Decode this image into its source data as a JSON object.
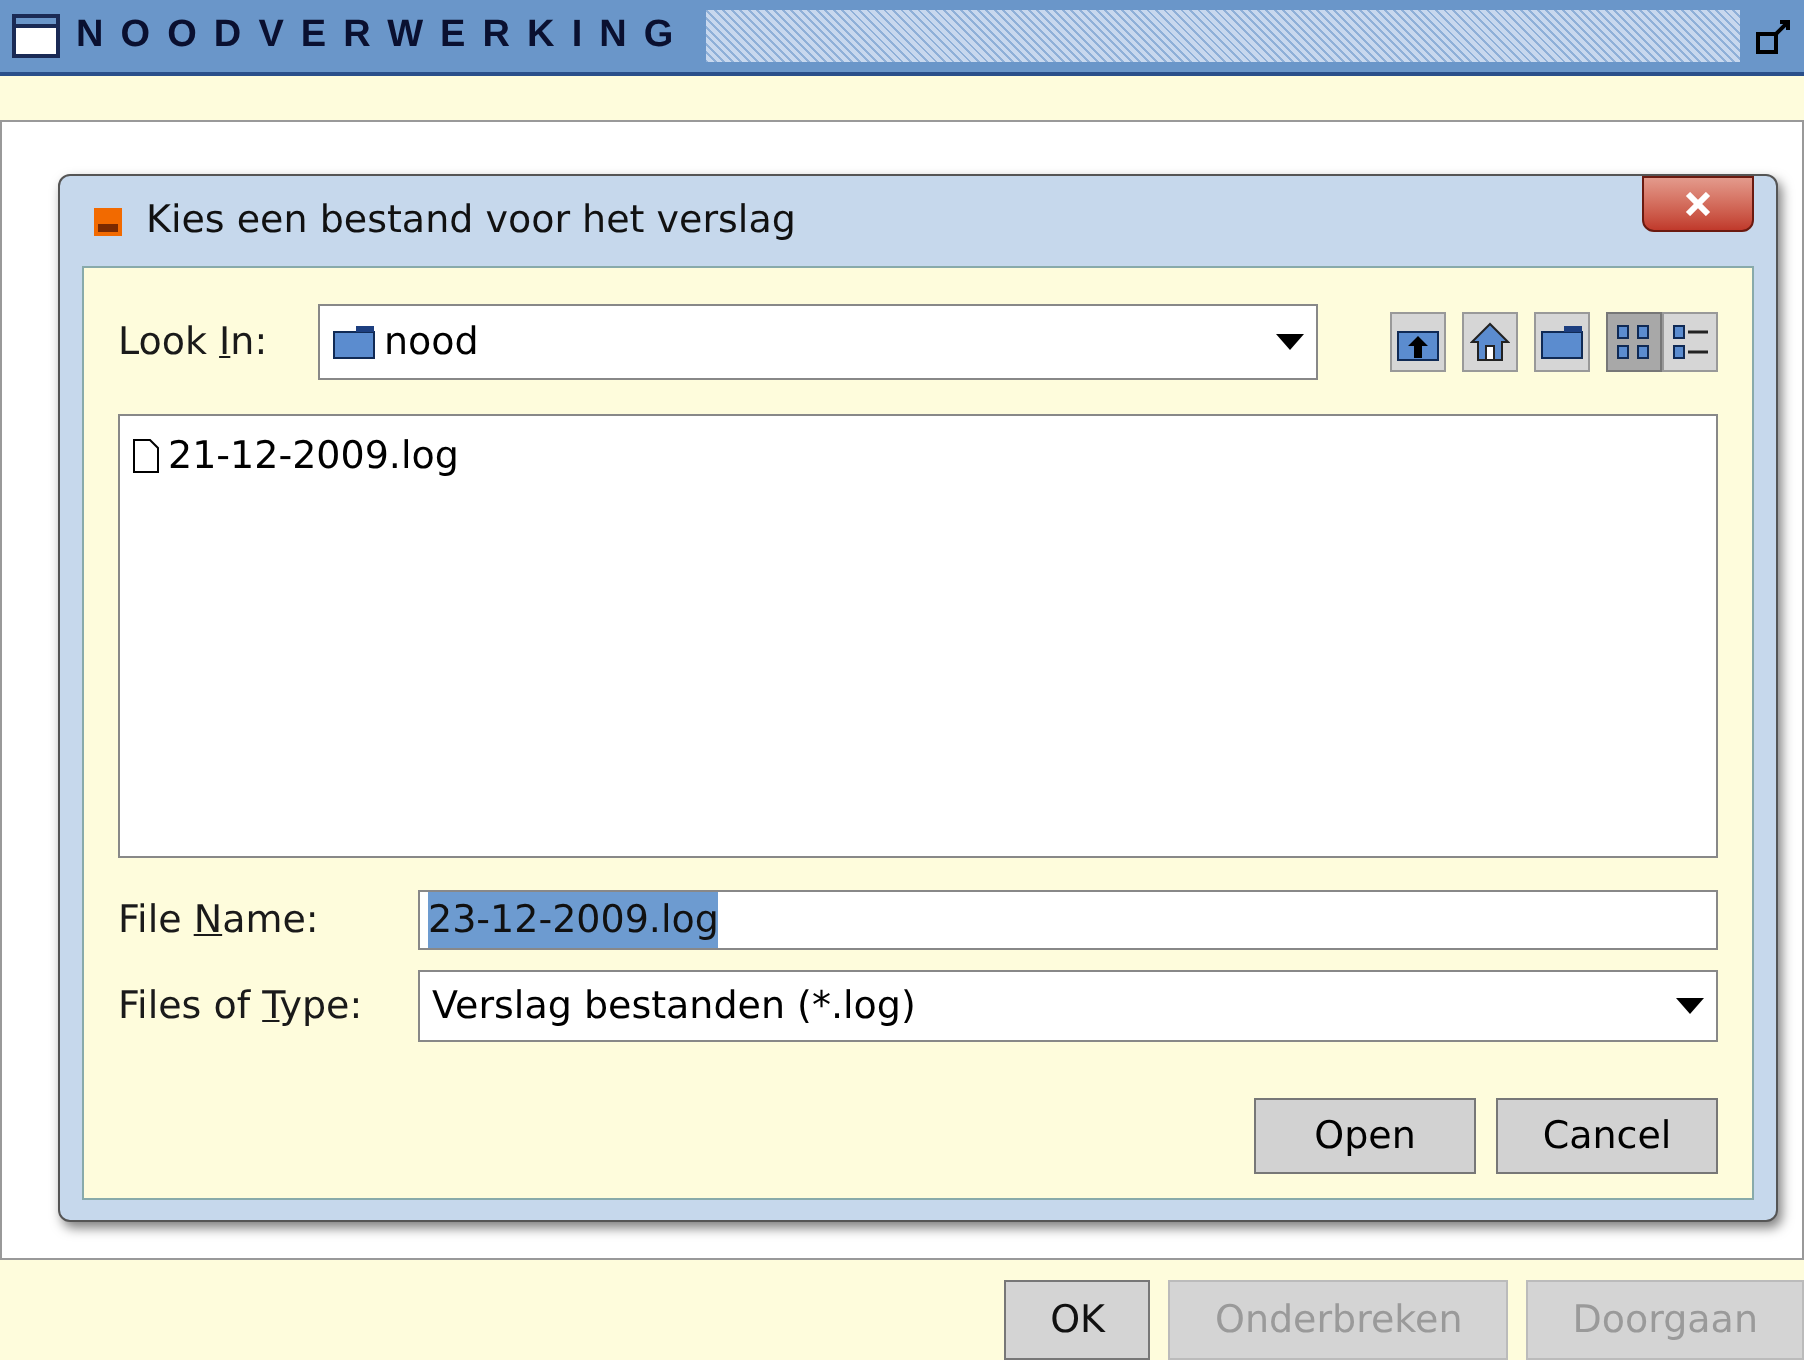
{
  "window": {
    "title": "NOODVERWERKING"
  },
  "dialog": {
    "title": "Kies een bestand voor het verslag",
    "look_in": {
      "label": {
        "pre": "Look ",
        "key": "I",
        "post": "n:"
      },
      "value": "nood"
    },
    "toolbar": [
      {
        "kind": "up",
        "selected": false
      },
      {
        "kind": "home",
        "selected": false
      },
      {
        "kind": "newfolder",
        "selected": false
      },
      {
        "kind": "list",
        "selected": true
      },
      {
        "kind": "details",
        "selected": false
      }
    ],
    "files": [
      {
        "name": "21-12-2009.log"
      }
    ],
    "file_name": {
      "label": {
        "pre": "File ",
        "key": "N",
        "post": "ame:"
      },
      "value": "23-12-2009.log"
    },
    "file_type": {
      "label": {
        "pre": "Files of ",
        "key": "T",
        "post": "ype:"
      },
      "value": "Verslag bestanden (*.log)"
    },
    "buttons": [
      "Open",
      "Cancel"
    ]
  },
  "footer_buttons": [
    {
      "label": "OK",
      "disabled": false
    },
    {
      "label": "Onderbreken",
      "disabled": true
    },
    {
      "label": "Doorgaan",
      "disabled": true
    }
  ]
}
